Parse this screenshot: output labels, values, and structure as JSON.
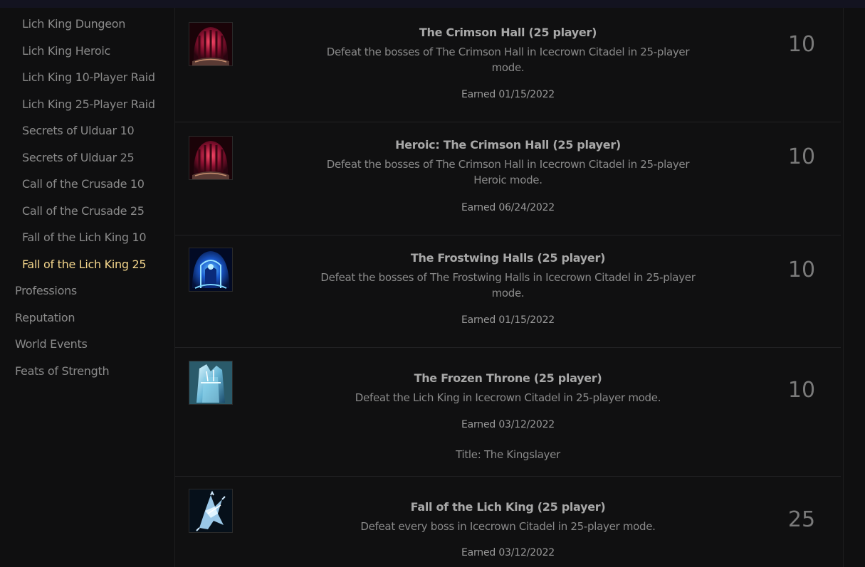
{
  "sidebar": {
    "items": [
      {
        "label": "Lich King Dungeon",
        "level": "sub",
        "active": false
      },
      {
        "label": "Lich King Heroic",
        "level": "sub",
        "active": false
      },
      {
        "label": "Lich King 10-Player Raid",
        "level": "sub",
        "active": false
      },
      {
        "label": "Lich King 25-Player Raid",
        "level": "sub",
        "active": false
      },
      {
        "label": "Secrets of Ulduar 10",
        "level": "sub",
        "active": false
      },
      {
        "label": "Secrets of Ulduar 25",
        "level": "sub",
        "active": false
      },
      {
        "label": "Call of the Crusade 10",
        "level": "sub",
        "active": false
      },
      {
        "label": "Call of the Crusade 25",
        "level": "sub",
        "active": false
      },
      {
        "label": "Fall of the Lich King 10",
        "level": "sub",
        "active": false
      },
      {
        "label": "Fall of the Lich King 25",
        "level": "sub",
        "active": true
      },
      {
        "label": "Professions",
        "level": "top",
        "active": false
      },
      {
        "label": "Reputation",
        "level": "top",
        "active": false
      },
      {
        "label": "World Events",
        "level": "top",
        "active": false
      },
      {
        "label": "Feats of Strength",
        "level": "top",
        "active": false
      }
    ]
  },
  "achievements": [
    {
      "icon": "crimson-hall-icon",
      "title": "The Crimson Hall (25 player)",
      "description_line1": "Defeat the bosses of The Crimson Hall in Icecrown Citadel in 25-player",
      "description_line2": "mode.",
      "earned": "Earned 01/15/2022",
      "reward": "",
      "points": "10"
    },
    {
      "icon": "crimson-hall-icon",
      "title": "Heroic: The Crimson Hall (25 player)",
      "description_line1": "Defeat the bosses of The Crimson Hall in Icecrown Citadel in 25-player",
      "description_line2": "Heroic mode.",
      "earned": "Earned 06/24/2022",
      "reward": "",
      "points": "10"
    },
    {
      "icon": "frostwing-halls-icon",
      "title": "The Frostwing Halls (25 player)",
      "description_line1": "Defeat the bosses of The Frostwing Halls in Icecrown Citadel in 25-player",
      "description_line2": "mode.",
      "earned": "Earned 01/15/2022",
      "reward": "",
      "points": "10"
    },
    {
      "icon": "frozen-throne-icon",
      "title": "The Frozen Throne (25 player)",
      "description_line1": "Defeat the Lich King in Icecrown Citadel in 25-player mode.",
      "description_line2": "",
      "earned": "Earned 03/12/2022",
      "reward": "Title: The Kingslayer",
      "points": "10"
    },
    {
      "icon": "lich-king-icon",
      "title": "Fall of the Lich King (25 player)",
      "description_line1": "Defeat every boss in Icecrown Citadel in 25-player mode.",
      "description_line2": "",
      "earned": "Earned 03/12/2022",
      "reward": "",
      "points": "25"
    }
  ]
}
